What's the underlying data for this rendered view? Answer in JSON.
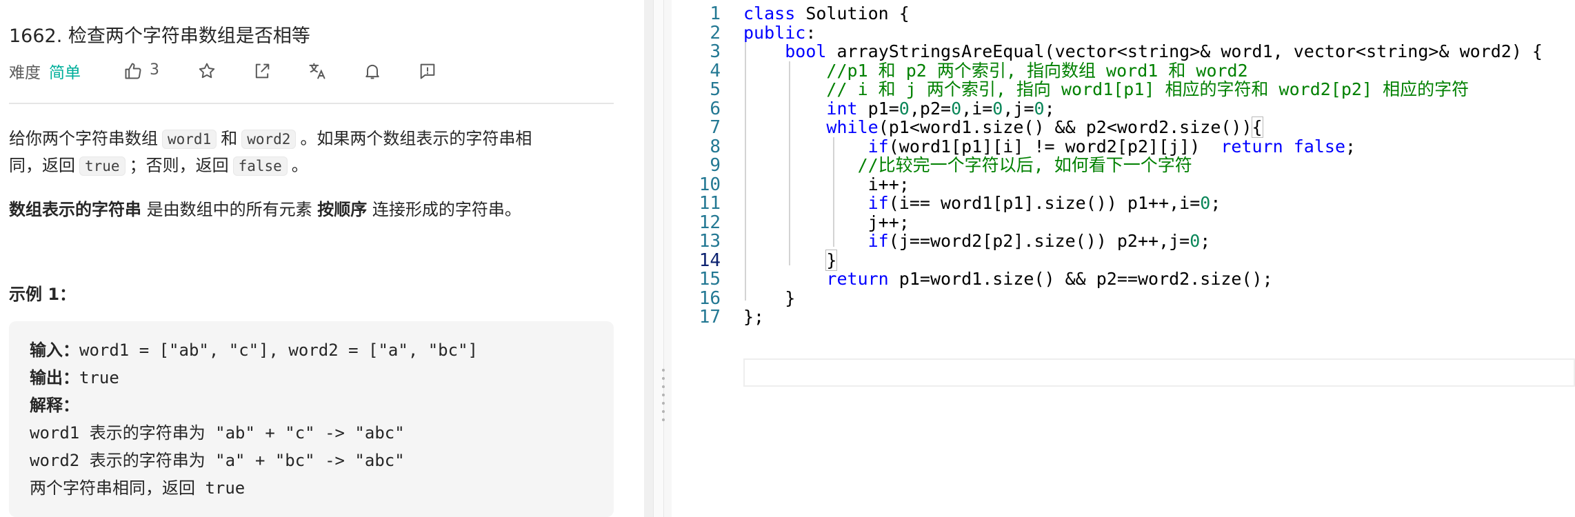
{
  "problem": {
    "title": "1662. 检查两个字符串数组是否相等",
    "difficulty_label": "难度",
    "difficulty_value": "简单",
    "like_count": "3",
    "description": {
      "p1_before": "给你两个字符串数组",
      "p1_code1": "word1",
      "p1_and": "和",
      "p1_code2": "word2",
      "p1_after": "。如果两个数组表示的字符串相",
      "p2_before": "同，返回",
      "p2_code_true": "true",
      "p2_mid": "；否则，返回",
      "p2_code_false": "false",
      "p2_end": "。",
      "p3_bold1": "数组表示的字符串",
      "p3_mid": "是由数组中的所有元素",
      "p3_bold2": "按顺序",
      "p3_end": "连接形成的字符串。"
    },
    "example_title": "示例 1：",
    "example": {
      "input_key": "输入：",
      "input_val": "word1 = [\"ab\", \"c\"], word2 = [\"a\", \"bc\"]",
      "output_key": "输出：",
      "output_val": "true",
      "explain_key": "解释：",
      "explain_line1": "word1 表示的字符串为 \"ab\" + \"c\" -> \"abc\"",
      "explain_line2": "word2 表示的字符串为 \"a\" + \"bc\" -> \"abc\"",
      "explain_line3": "两个字符串相同，返回 true"
    }
  },
  "editor": {
    "active_line": 14,
    "line_numbers": [
      "1",
      "2",
      "3",
      "4",
      "5",
      "6",
      "7",
      "8",
      "9",
      "10",
      "11",
      "12",
      "13",
      "14",
      "15",
      "16",
      "17"
    ],
    "lines": [
      [
        {
          "t": "class",
          "c": "kw"
        },
        {
          "t": " Solution {"
        }
      ],
      [
        {
          "t": "public",
          "c": "kw"
        },
        {
          "t": ":"
        }
      ],
      [
        {
          "t": "    "
        },
        {
          "t": "bool",
          "c": "kw"
        },
        {
          "t": " arrayStringsAreEqual(vector<string>& word1, vector<string>& word2) {"
        }
      ],
      [
        {
          "t": "        "
        },
        {
          "t": "//p1 和 p2 两个索引, 指向数组 word1 和 word2",
          "c": "cm"
        }
      ],
      [
        {
          "t": "        "
        },
        {
          "t": "// i 和 j 两个索引, 指向 word1[p1] 相应的字符和 word2[p2] 相应的字符",
          "c": "cm"
        }
      ],
      [
        {
          "t": "        "
        },
        {
          "t": "int",
          "c": "kw"
        },
        {
          "t": " p1="
        },
        {
          "t": "0",
          "c": "num"
        },
        {
          "t": ",p2="
        },
        {
          "t": "0",
          "c": "num"
        },
        {
          "t": ",i="
        },
        {
          "t": "0",
          "c": "num"
        },
        {
          "t": ",j="
        },
        {
          "t": "0",
          "c": "num"
        },
        {
          "t": ";"
        }
      ],
      [
        {
          "t": "        "
        },
        {
          "t": "while",
          "c": "kw"
        },
        {
          "t": "(p1<word1.size() && p2<word2.size())"
        },
        {
          "t": "{",
          "c": "hl"
        }
      ],
      [
        {
          "t": "            "
        },
        {
          "t": "if",
          "c": "kw"
        },
        {
          "t": "(word1[p1][i] != word2[p2][j])  "
        },
        {
          "t": "return",
          "c": "kw"
        },
        {
          "t": " "
        },
        {
          "t": "false",
          "c": "kw"
        },
        {
          "t": ";"
        }
      ],
      [
        {
          "t": "           "
        },
        {
          "t": "//比较完一个字符以后, 如何看下一个字符",
          "c": "cm"
        }
      ],
      [
        {
          "t": "            i++;"
        }
      ],
      [
        {
          "t": "            "
        },
        {
          "t": "if",
          "c": "kw"
        },
        {
          "t": "(i== word1[p1].size()) p1++,i="
        },
        {
          "t": "0",
          "c": "num"
        },
        {
          "t": ";"
        }
      ],
      [
        {
          "t": "            j++;"
        }
      ],
      [
        {
          "t": "            "
        },
        {
          "t": "if",
          "c": "kw"
        },
        {
          "t": "(j==word2[p2].size()) p2++,j="
        },
        {
          "t": "0",
          "c": "num"
        },
        {
          "t": ";"
        }
      ],
      [
        {
          "t": "        "
        },
        {
          "t": "}",
          "c": "hl"
        }
      ],
      [
        {
          "t": "        "
        },
        {
          "t": "return",
          "c": "kw"
        },
        {
          "t": " p1=word1.size() && p2==word2.size();"
        }
      ],
      [
        {
          "t": "    }"
        }
      ],
      [
        {
          "t": "};"
        }
      ]
    ]
  },
  "colors": {
    "difficulty_easy": "#00af9b",
    "keyword": "#0000ff",
    "number": "#098658",
    "comment": "#008000",
    "line_number": "#237893"
  },
  "icons": [
    "thumbs-up-icon",
    "star-icon",
    "share-icon",
    "translate-icon",
    "bell-icon",
    "feedback-icon"
  ]
}
